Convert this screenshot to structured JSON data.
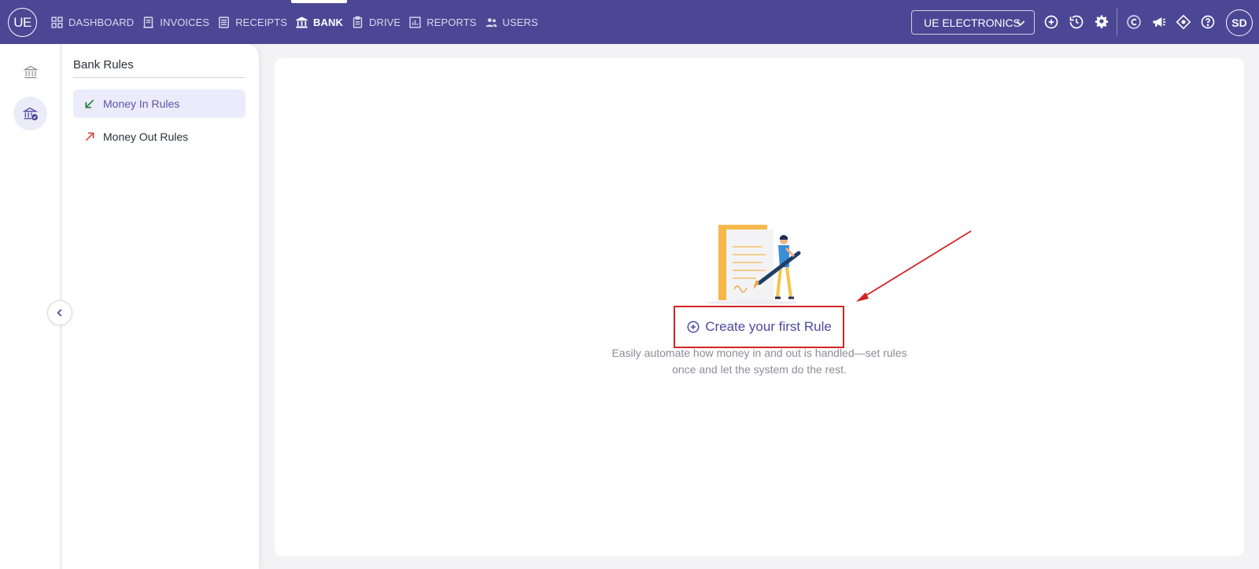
{
  "topbar": {
    "logo_text": "UE",
    "nav": [
      {
        "label": "DASHBOARD",
        "icon": "grid-icon"
      },
      {
        "label": "INVOICES",
        "icon": "invoice-icon"
      },
      {
        "label": "RECEIPTS",
        "icon": "receipt-icon"
      },
      {
        "label": "BANK",
        "icon": "bank-icon",
        "active": true
      },
      {
        "label": "DRIVE",
        "icon": "clipboard-icon"
      },
      {
        "label": "REPORTS",
        "icon": "chart-icon"
      },
      {
        "label": "USERS",
        "icon": "users-icon"
      }
    ],
    "company": "UE ELECTRONICS",
    "avatar_initials": "SD"
  },
  "sidebar": {
    "title": "Bank Rules",
    "items": [
      {
        "label": "Money In Rules",
        "icon": "arrow-down-left-icon",
        "active": true
      },
      {
        "label": "Money Out Rules",
        "icon": "arrow-up-right-icon"
      }
    ]
  },
  "empty_state": {
    "button_label": "Create your first Rule",
    "description": "Easily automate how money in and out is handled—set rules once and let the system do the rest."
  },
  "colors": {
    "topbar": "#4b4794",
    "accent": "#4d49a0",
    "money_in": "#1e7f3a",
    "money_out": "#d24a3a",
    "annotation": "#d32424"
  }
}
